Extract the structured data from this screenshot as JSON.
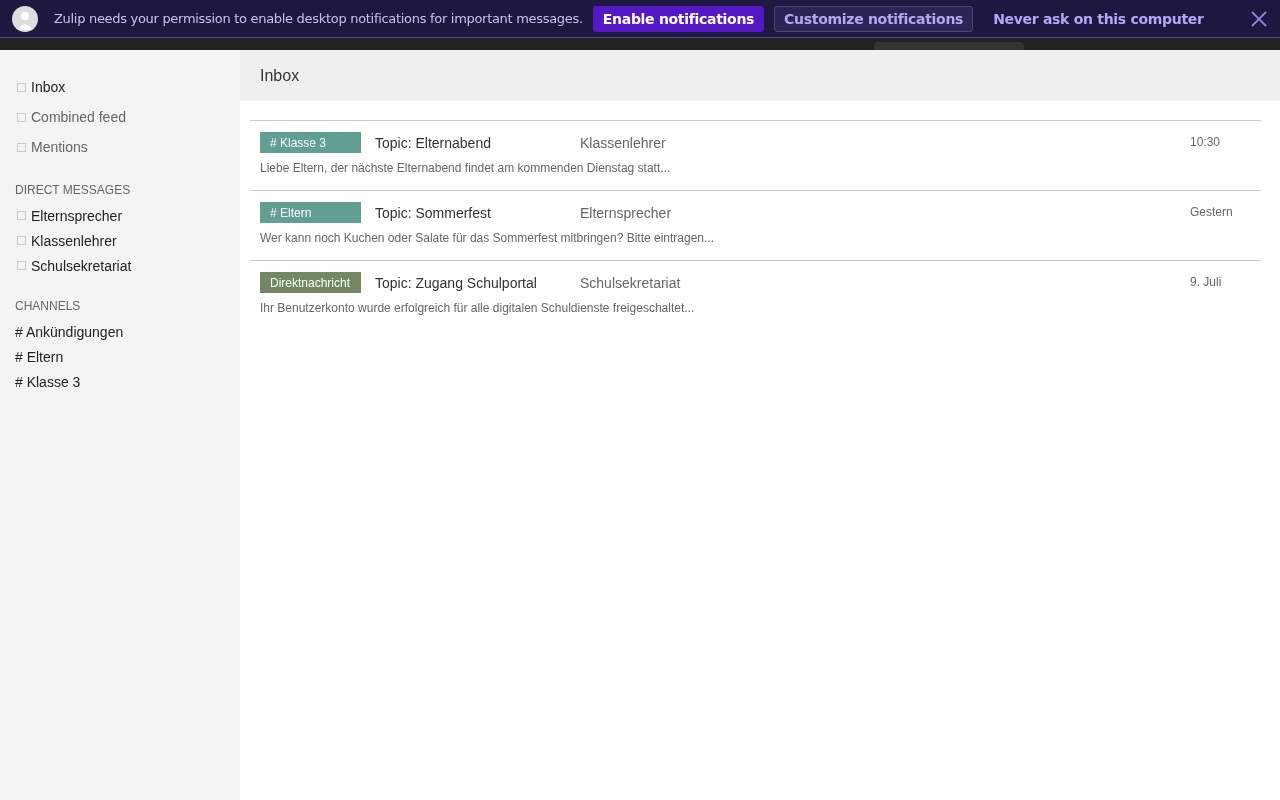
{
  "banner": {
    "message": "Zulip needs your permission to enable desktop notifications for important messages.",
    "buttons": [
      {
        "kind": "primary",
        "label": "Enable notifications"
      },
      {
        "kind": "secondary",
        "label": "Customize notifications"
      },
      {
        "kind": "link",
        "label": "Never ask on this computer"
      }
    ]
  },
  "sidebar": {
    "views": [
      {
        "label": "Inbox",
        "selected": true
      },
      {
        "label": "Combined feed",
        "selected": false
      },
      {
        "label": "Mentions",
        "selected": false
      }
    ],
    "direct_messages": {
      "heading": "DIRECT MESSAGES",
      "items": [
        "Elternsprecher",
        "Klassenlehrer",
        "Schulsekretariat"
      ]
    },
    "channels": {
      "heading": "CHANNELS",
      "items": [
        "# Ankündigungen",
        "# Eltern",
        "# Klasse 3"
      ]
    }
  },
  "main": {
    "title": "Inbox",
    "messages": [
      {
        "tag": "# Klasse 3",
        "color": "#619e94",
        "topic": "Topic: Elternabend",
        "sender": "Klassenlehrer",
        "time": "10:30",
        "preview": "Liebe Eltern, der nächste Elternabend findet am kommenden Dienstag statt..."
      },
      {
        "tag": "# Eltern",
        "color": "#619e94",
        "topic": "Topic: Sommerfest",
        "sender": "Elternsprecher",
        "time": "Gestern",
        "preview": "Wer kann noch Kuchen oder Salate für das Sommerfest mitbringen? Bitte eintragen..."
      },
      {
        "tag": "Direktnachricht",
        "color": "#728762",
        "topic": "Topic: Zugang Schulportal",
        "sender": "Schulsekretariat",
        "time": "9. Juli",
        "preview": "Ihr Benutzerkonto wurde erfolgreich für alle digitalen Schuldienste freigeschaltet..."
      }
    ]
  }
}
